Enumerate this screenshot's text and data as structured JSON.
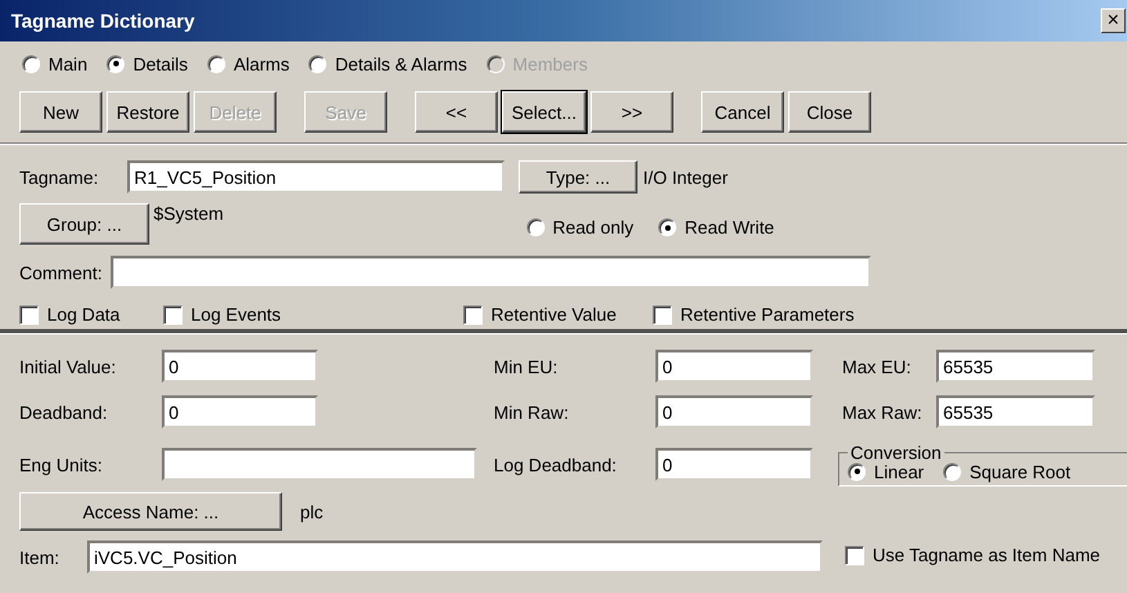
{
  "window": {
    "title": "Tagname Dictionary",
    "close": "×"
  },
  "view_options": [
    {
      "label": "Main",
      "selected": false,
      "disabled": false
    },
    {
      "label": "Details",
      "selected": true,
      "disabled": false
    },
    {
      "label": "Alarms",
      "selected": false,
      "disabled": false
    },
    {
      "label": "Details & Alarms",
      "selected": false,
      "disabled": false
    },
    {
      "label": "Members",
      "selected": false,
      "disabled": true
    }
  ],
  "toolbar": [
    {
      "buttons": [
        {
          "label": "New",
          "disabled": false,
          "default": false
        },
        {
          "label": "Restore",
          "disabled": false,
          "default": false
        },
        {
          "label": "Delete",
          "disabled": true,
          "default": false
        }
      ]
    },
    {
      "buttons": [
        {
          "label": "Save",
          "disabled": true,
          "default": false
        }
      ]
    },
    {
      "buttons": [
        {
          "label": "<<",
          "disabled": false,
          "default": false
        },
        {
          "label": "Select...",
          "disabled": false,
          "default": true
        },
        {
          "label": ">>",
          "disabled": false,
          "default": false
        }
      ]
    },
    {
      "buttons": [
        {
          "label": "Cancel",
          "disabled": false,
          "default": false
        },
        {
          "label": "Close",
          "disabled": false,
          "default": false
        }
      ]
    }
  ],
  "tagname": {
    "label": "Tagname:",
    "value": "R1_VC5_Position"
  },
  "type": {
    "button": "Type: ...",
    "value": "I/O Integer"
  },
  "group": {
    "button": "Group: ...",
    "value": "$System"
  },
  "access_mode": [
    {
      "label": "Read only",
      "selected": false
    },
    {
      "label": "Read Write",
      "selected": true
    }
  ],
  "comment": {
    "label": "Comment:"
  },
  "log_options": [
    {
      "label": "Log Data",
      "checked": false
    },
    {
      "label": "Log Events",
      "checked": false
    },
    {
      "label": "Retentive Value",
      "checked": false
    },
    {
      "label": "Retentive Parameters",
      "checked": false
    }
  ],
  "initial_value": {
    "label": "Initial Value:",
    "value": "0"
  },
  "min_eu": {
    "label": "Min EU:",
    "value": "0"
  },
  "max_eu": {
    "label": "Max EU:",
    "value": "65535"
  },
  "deadband": {
    "label": "Deadband:",
    "value": "0"
  },
  "min_raw": {
    "label": "Min Raw:",
    "value": "0"
  },
  "max_raw": {
    "label": "Max Raw:",
    "value": "65535"
  },
  "eng_units": {
    "label": "Eng Units:"
  },
  "log_deadband": {
    "label": "Log Deadband:",
    "value": "0"
  },
  "conversion": {
    "title": "Conversion",
    "options": [
      {
        "label": "Linear",
        "selected": true
      },
      {
        "label": "Square Root",
        "selected": false
      }
    ]
  },
  "access_name": {
    "button": "Access Name: ...",
    "value": "plc"
  },
  "item": {
    "label": "Item:",
    "value": "iVC5.VC_Position"
  },
  "use_tagname": {
    "label": "Use Tagname as Item Name",
    "checked": false
  }
}
